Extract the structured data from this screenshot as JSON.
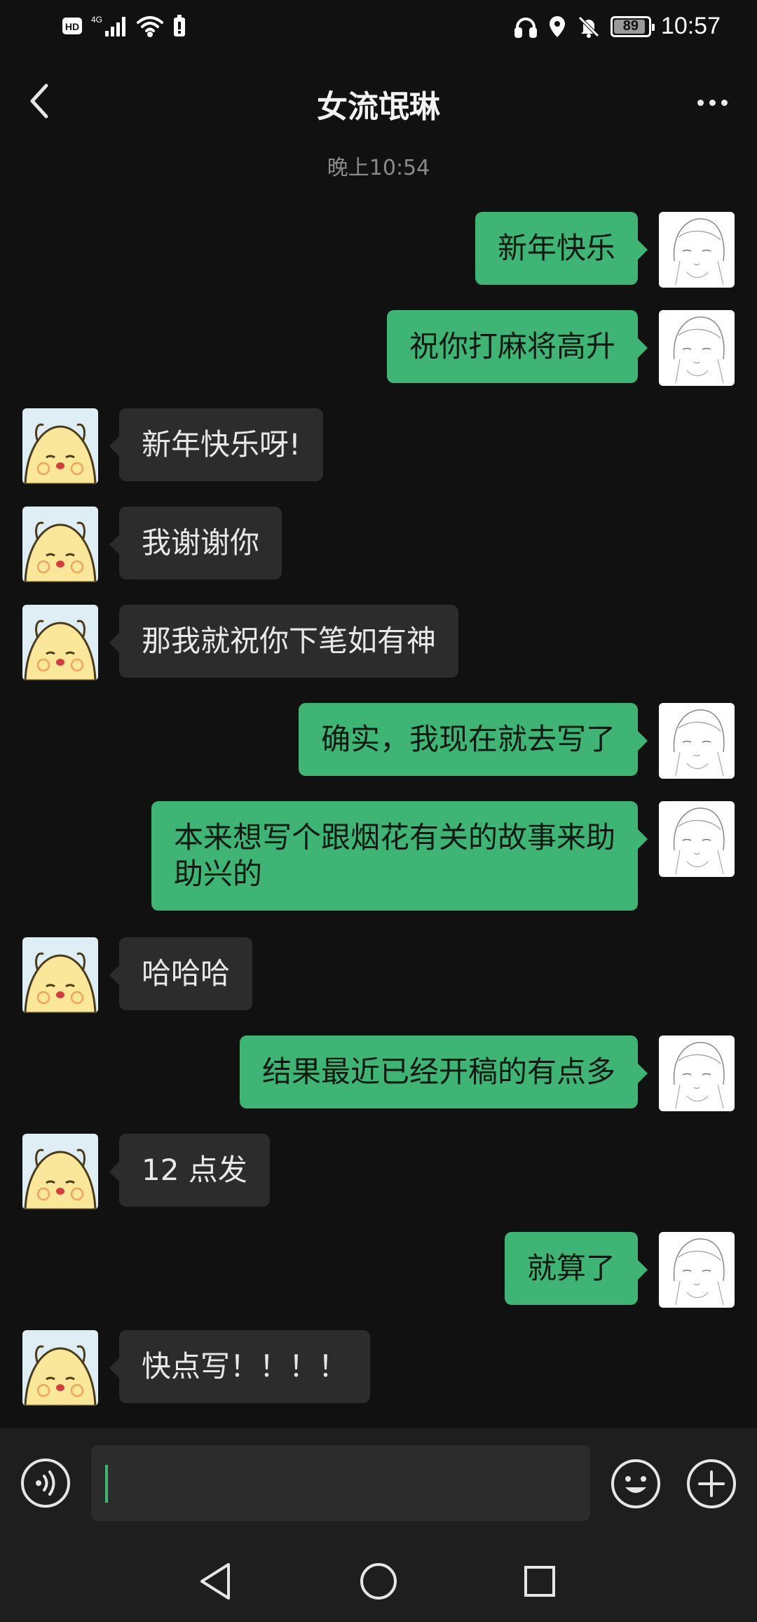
{
  "status_bar": {
    "left_icons": [
      "hd-icon",
      "signal-4g-icon",
      "wifi-icon",
      "battery-saver-icon"
    ],
    "network_label": "4G",
    "hd_label": "HD",
    "right_icons": [
      "headphones-icon",
      "location-icon",
      "bell-muted-icon"
    ],
    "battery_level": "89",
    "time": "10:57"
  },
  "header": {
    "title": "女流氓琳",
    "back_icon": "chevron-left-icon",
    "more_icon": "more-dots-icon"
  },
  "timestamp": "晚上10:54",
  "messages": [
    {
      "side": "out",
      "text": "新年快乐"
    },
    {
      "side": "out",
      "text": "祝你打麻将高升"
    },
    {
      "side": "in",
      "text": "新年快乐呀!"
    },
    {
      "side": "in",
      "text": "我谢谢你"
    },
    {
      "side": "in",
      "text": "那我就祝你下笔如有神"
    },
    {
      "side": "out",
      "text": "确实，我现在就去写了"
    },
    {
      "side": "out",
      "text": "本来想写个跟烟花有关的故事来助\n助兴的"
    },
    {
      "side": "in",
      "text": "哈哈哈"
    },
    {
      "side": "out",
      "text": "结果最近已经开稿的有点多"
    },
    {
      "side": "in",
      "text": "12 点发"
    },
    {
      "side": "out",
      "text": "就算了"
    },
    {
      "side": "in",
      "text": "快点写！！！！"
    }
  ],
  "input_bar": {
    "value": "",
    "voice_icon": "voice-input-icon",
    "emoji_icon": "emoji-icon",
    "plus_icon": "plus-icon"
  },
  "nav_bar": {
    "icons": [
      "nav-back-icon",
      "nav-home-icon",
      "nav-recents-icon"
    ]
  },
  "colors": {
    "background": "#111111",
    "incoming_bubble": "#2c2c2c",
    "outgoing_bubble": "#3eb575",
    "accent": "#3eb575"
  }
}
